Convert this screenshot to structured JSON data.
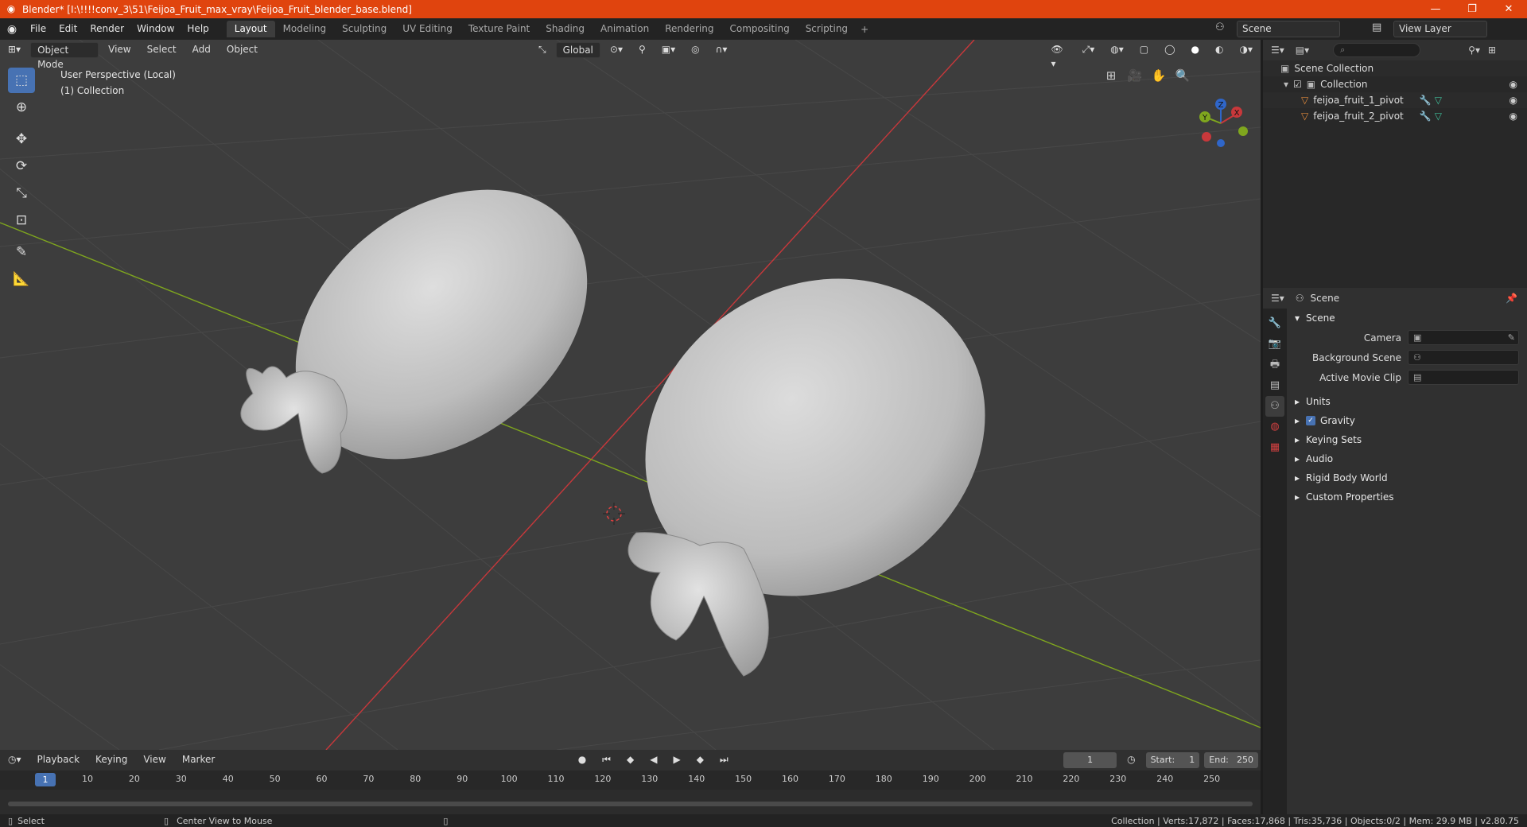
{
  "title": "Blender* [I:\\!!!!conv_3\\51\\Feijoa_Fruit_max_vray\\Feijoa_Fruit_blender_base.blend]",
  "menus": [
    "File",
    "Edit",
    "Render",
    "Window",
    "Help"
  ],
  "workspaces": [
    "Layout",
    "Modeling",
    "Sculpting",
    "UV Editing",
    "Texture Paint",
    "Shading",
    "Animation",
    "Rendering",
    "Compositing",
    "Scripting"
  ],
  "scene_name": "Scene",
  "view_layer": "View Layer",
  "viewport": {
    "mode": "Object Mode",
    "menus": [
      "View",
      "Select",
      "Add",
      "Object"
    ],
    "orientation": "Global",
    "info_line1": "User Perspective (Local)",
    "info_line2": "(1) Collection"
  },
  "outliner": {
    "root": "Scene Collection",
    "collection": "Collection",
    "items": [
      "feijoa_fruit_1_pivot",
      "feijoa_fruit_2_pivot"
    ]
  },
  "properties": {
    "header": "Scene",
    "section": "Scene",
    "fields": [
      {
        "label": "Camera",
        "value": ""
      },
      {
        "label": "Background Scene",
        "value": ""
      },
      {
        "label": "Active Movie Clip",
        "value": ""
      }
    ],
    "panels": [
      "Units",
      "Gravity",
      "Keying Sets",
      "Audio",
      "Rigid Body World",
      "Custom Properties"
    ]
  },
  "timeline": {
    "menus": [
      "Playback",
      "Keying",
      "View",
      "Marker"
    ],
    "current_frame": "1",
    "start_label": "Start:",
    "start": "1",
    "end_label": "End:",
    "end": "250",
    "ticks": [
      "1",
      "10",
      "20",
      "30",
      "40",
      "50",
      "60",
      "70",
      "80",
      "90",
      "100",
      "110",
      "120",
      "130",
      "140",
      "150",
      "160",
      "170",
      "180",
      "190",
      "200",
      "210",
      "220",
      "230",
      "240",
      "250"
    ]
  },
  "status": {
    "left": "Select",
    "middle": "Center View to Mouse",
    "right": "Collection | Verts:17,872 | Faces:17,868 | Tris:35,736 | Objects:0/2 | Mem: 29.9 MB | v2.80.75"
  },
  "colors": {
    "accent": "#4772b3",
    "titlebar": "#e0440e",
    "x_axis": "#c8383b",
    "y_axis": "#7fa61e"
  }
}
